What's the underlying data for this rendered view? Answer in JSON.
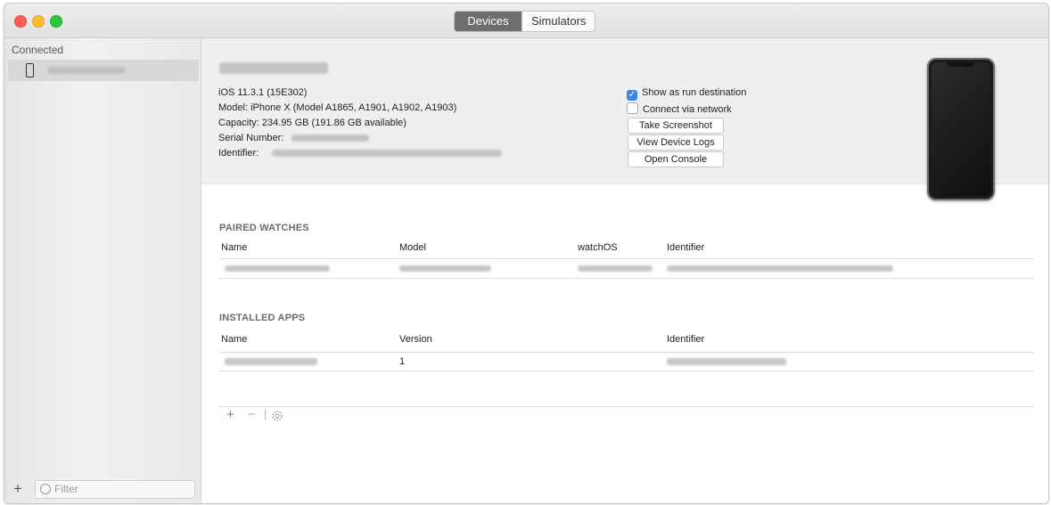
{
  "window": {
    "tabs": [
      {
        "label": "Devices",
        "selected": true
      },
      {
        "label": "Simulators",
        "selected": false
      }
    ]
  },
  "sidebar": {
    "section_label": "Connected",
    "filter_placeholder": "Filter",
    "add_symbol": "+"
  },
  "device": {
    "ios_version": "iOS 11.3.1 (15E302)",
    "model": "Model: iPhone X (Model A1865, A1901, A1902, A1903)",
    "capacity": "Capacity: 234.95 GB (191.86 GB available)",
    "serial_label": "Serial Number:",
    "identifier_label": "Identifier:"
  },
  "options": {
    "show_as_run_destination": {
      "label": "Show as run destination",
      "checked": true
    },
    "connect_via_network": {
      "label": "Connect via network",
      "checked": false
    },
    "check_glyph": "✓"
  },
  "buttons": {
    "take_screenshot": "Take Screenshot",
    "view_device_logs": "View Device Logs",
    "open_console": "Open Console"
  },
  "paired_watches": {
    "title": "PAIRED WATCHES",
    "columns": [
      "Name",
      "Model",
      "watchOS",
      "Identifier"
    ]
  },
  "installed_apps": {
    "title": "INSTALLED APPS",
    "columns": [
      "Name",
      "Version",
      "Identifier"
    ],
    "rows": [
      {
        "version": "1"
      }
    ]
  },
  "toolbar": {
    "add_symbol": "+",
    "remove_symbol": "−",
    "separator": "|"
  },
  "colors": {
    "checkbox_accent": "#3a86e4",
    "segment_selected": "#6e6e6e"
  },
  "icons": [
    "phone-icon",
    "filter-icon",
    "gear-icon",
    "iphone-image"
  ]
}
